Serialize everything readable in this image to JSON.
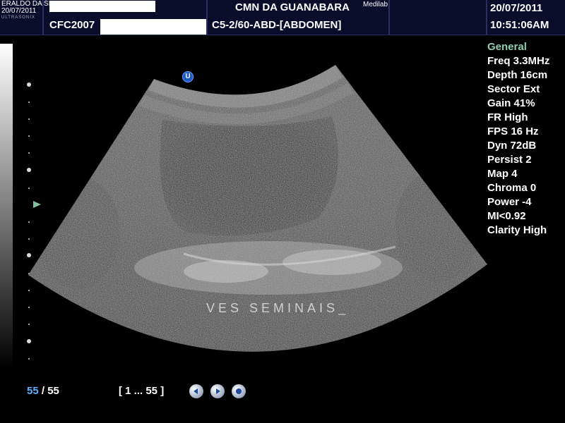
{
  "header": {
    "patient_name_partial": "ERALDO DA SI",
    "patient_date_small": "20/07/2011",
    "name_trailing": ",",
    "brand": "ULTRASONIX",
    "patient_id_partial": "CFC2007",
    "institution": "CMN DA GUANABARA",
    "superscript": "Medilab",
    "probe_preset": "C5-2/60-ABD-[ABDOMEN]",
    "date": "20/07/2011",
    "time": "10:51:06AM"
  },
  "image": {
    "orientation_marker": "U",
    "annotation": "VES SEMINAIS_"
  },
  "params": {
    "header": "General",
    "items": [
      "Freq 3.3MHz",
      "Depth 16cm",
      "Sector Ext",
      "Gain 41%",
      "FR High",
      "FPS 16 Hz",
      "Dyn 72dB",
      "Persist 2",
      "Map 4",
      "Chroma 0",
      "Power -4",
      "MI<0.92",
      "Clarity High"
    ]
  },
  "footer": {
    "frame_current": "55",
    "frame_separator": " / ",
    "frame_total": "55",
    "frame_range": "[ 1 ... 55 ]",
    "controls": [
      "prev-icon",
      "play-icon",
      "stop-icon"
    ]
  }
}
